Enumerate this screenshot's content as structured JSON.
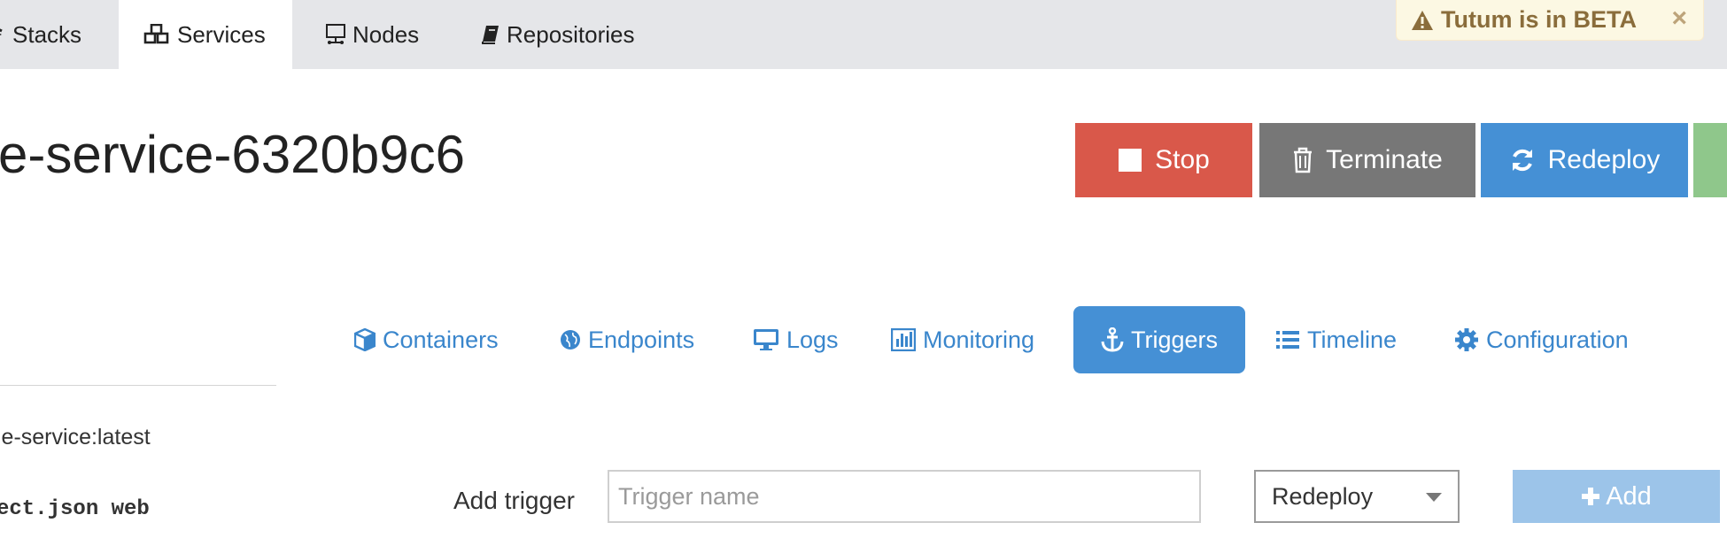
{
  "nav": {
    "tabs": [
      {
        "label": "Stacks",
        "icon": "stacks-icon"
      },
      {
        "label": "Services",
        "icon": "services-cubes-icon",
        "active": true
      },
      {
        "label": "Nodes",
        "icon": "nodes-server-icon"
      },
      {
        "label": "Repositories",
        "icon": "book-icon"
      }
    ]
  },
  "beta": {
    "text": "Tutum is in BETA",
    "close": "×"
  },
  "service": {
    "title": "e-service-6320b9c6"
  },
  "actions": {
    "stop": "Stop",
    "terminate": "Terminate",
    "redeploy": "Redeploy"
  },
  "subtabs": [
    {
      "label": "Containers",
      "icon": "cube-icon"
    },
    {
      "label": "Endpoints",
      "icon": "globe-icon"
    },
    {
      "label": "Logs",
      "icon": "monitor-icon"
    },
    {
      "label": "Monitoring",
      "icon": "bar-chart-icon"
    },
    {
      "label": "Triggers",
      "icon": "anchor-icon",
      "active": true
    },
    {
      "label": "Timeline",
      "icon": "list-icon"
    },
    {
      "label": "Configuration",
      "icon": "gear-icon"
    }
  ],
  "sidebar": {
    "image": "le-service:latest",
    "command": "ect.json web"
  },
  "trigger_form": {
    "label": "Add trigger",
    "name_placeholder": "Trigger name",
    "name_value": "",
    "type_selected": "Redeploy",
    "add_label": "Add"
  },
  "colors": {
    "stop": "#d9584a",
    "terminate": "#777777",
    "redeploy": "#4590d5",
    "link": "#3a86cc",
    "beta_text": "#8a6d3b",
    "add_disabled": "#9cc4e9"
  }
}
